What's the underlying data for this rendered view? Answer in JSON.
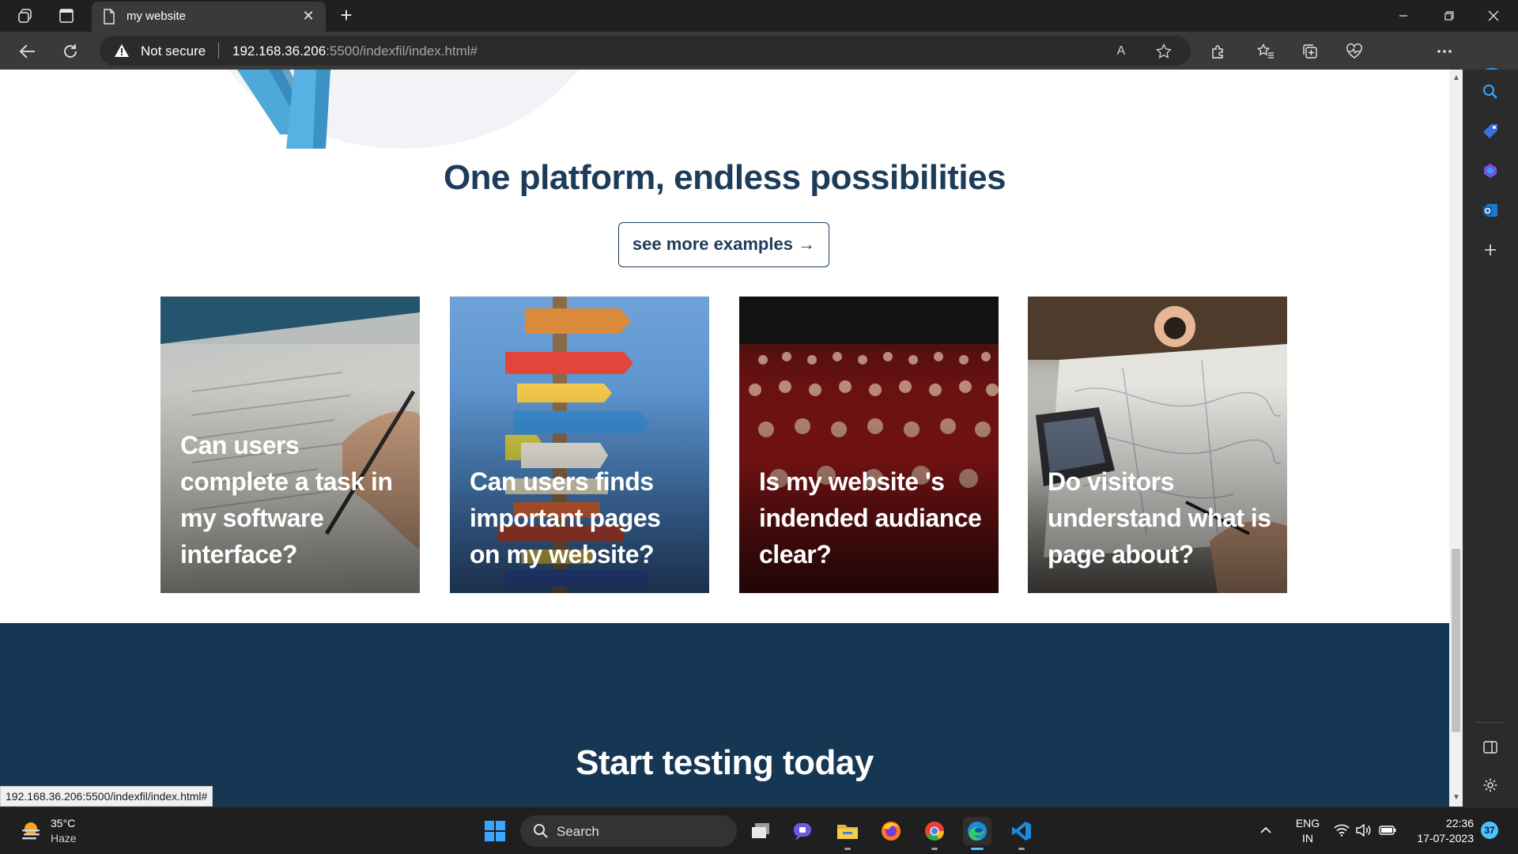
{
  "browser": {
    "tab": {
      "title": "my website",
      "close": "✕"
    },
    "new_tab": "+",
    "security_label": "Not secure",
    "url_host": "192.168.36.206",
    "url_rest": ":5500/indexfil/index.html#",
    "read_aloud": "A",
    "accent": "#2aa0ff"
  },
  "page": {
    "section_title": "One platform, endless possibilities",
    "see_more_label": "see more examples →",
    "cards": [
      {
        "title": "Can users complete a task in my software interface?"
      },
      {
        "title": "Can users finds important pages on my website?"
      },
      {
        "title": "Is my website 's indended audiance clear?"
      },
      {
        "title": "Do visitors understand what is page about?"
      }
    ],
    "start_title": "Start testing today",
    "heading_color": "#1d3c5a",
    "band_color": "#163754"
  },
  "status_bar": {
    "link": "192.168.36.206:5500/indexfil/index.html#"
  },
  "taskbar": {
    "weather_temp": "35°C",
    "weather_desc": "Haze",
    "search_placeholder": "Search",
    "lang_top": "ENG",
    "lang_bottom": "IN",
    "time": "22:36",
    "date": "17-07-2023",
    "notification_count": "37"
  }
}
